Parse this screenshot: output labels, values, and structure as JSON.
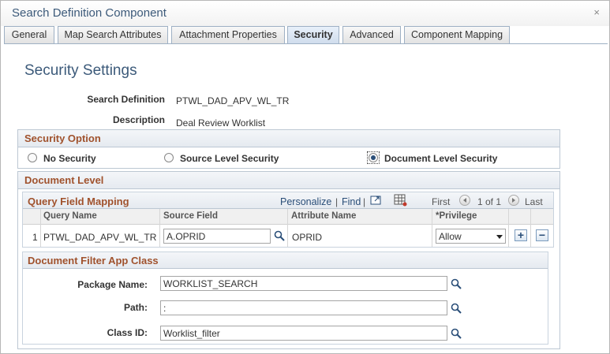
{
  "window": {
    "title": "Search Definition Component",
    "close_glyph": "×"
  },
  "tabs": [
    {
      "label": "General",
      "active": false
    },
    {
      "label": "Map Search Attributes",
      "active": false
    },
    {
      "label": "Attachment Properties",
      "active": false
    },
    {
      "label": "Security",
      "active": true
    },
    {
      "label": "Advanced",
      "active": false
    },
    {
      "label": "Component Mapping",
      "active": false
    }
  ],
  "page_title": "Security Settings",
  "fields": {
    "search_definition_label": "Search Definition",
    "search_definition_value": "PTWL_DAD_APV_WL_TR",
    "description_label": "Description",
    "description_value": "Deal Review Worklist"
  },
  "security_option": {
    "title": "Security Option",
    "options": [
      {
        "label": "No Security",
        "selected": false
      },
      {
        "label": "Source Level Security",
        "selected": false
      },
      {
        "label": "Document Level Security",
        "selected": true
      }
    ]
  },
  "document_level": {
    "title": "Document Level",
    "grid": {
      "title": "Query Field Mapping",
      "personalize": "Personalize",
      "separator": "|",
      "find": "Find",
      "first": "First",
      "range": "1 of 1",
      "last": "Last",
      "columns": [
        "Query Name",
        "Source Field",
        "Attribute Name",
        "*Privilege"
      ],
      "rows": [
        {
          "num": "1",
          "query_name": "PTWL_DAD_APV_WL_TR",
          "source_field": "A.OPRID",
          "attribute_name": "OPRID",
          "privilege": "Allow"
        }
      ],
      "add_glyph": "+",
      "delete_glyph": "−"
    }
  },
  "filter_app_class": {
    "title": "Document Filter App Class",
    "package_label": "Package Name:",
    "package_value": "WORKLIST_SEARCH",
    "path_label": "Path:",
    "path_value": ":",
    "class_label": "Class ID:",
    "class_value": "Worklist_filter"
  },
  "colors": {
    "accent": "#3c5a7a",
    "section_title": "#a0522d",
    "link": "#2a4e78"
  }
}
